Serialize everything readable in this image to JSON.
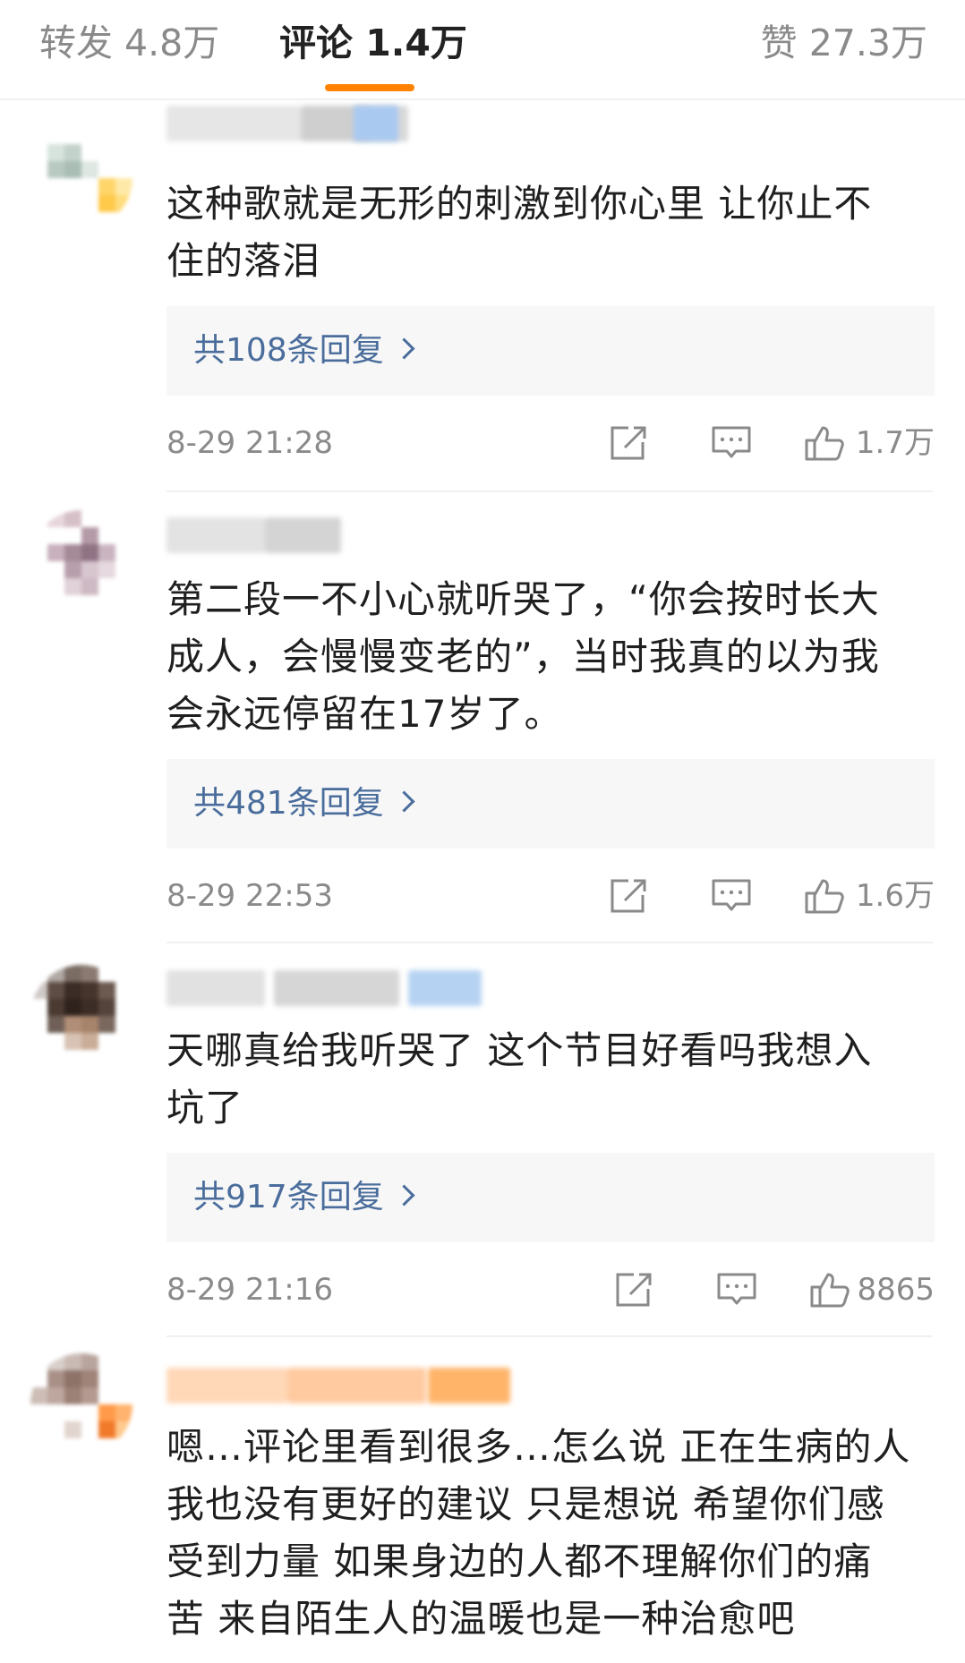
{
  "header": {
    "repost_label": "转发 4.8万",
    "comment_label": "评论 1.4万",
    "like_label": "赞 27.3万"
  },
  "comments": [
    {
      "text_lines": [
        "这种歌就是无形的刺激到你心里 让你止不",
        "住的落泪"
      ],
      "reply_label": "共108条回复",
      "time": "8-29 21:28",
      "likes": "1.7万"
    },
    {
      "text_lines": [
        "第二段一不小心就听哭了，“你会按时长大",
        "成人，会慢慢变老的”，当时我真的以为我",
        "会永远停留在17岁了。"
      ],
      "reply_label": "共481条回复",
      "time": "8-29 22:53",
      "likes": "1.6万"
    },
    {
      "text_lines": [
        "天哪真给我听哭了 这个节目好看吗我想入",
        "坑了"
      ],
      "reply_label": "共917条回复",
      "time": "8-29 21:16",
      "likes": "8865"
    },
    {
      "text_lines": [
        "嗯…评论里看到很多…怎么说 正在生病的人",
        "我也没有更好的建议 只是想说 希望你们感",
        "受到力量 如果身边的人都不理解你们的痛",
        "苦 来自陌生人的温暖也是一种治愈吧"
      ]
    }
  ],
  "colors": {
    "accent_underline": "#ff8200",
    "reply_link": "#4a6d9c",
    "reply_background": "#f7f7f7",
    "meta_text": "#8a8a8a"
  },
  "icons": [
    "share-icon",
    "comment-icon",
    "thumbs-up-icon",
    "chevron-right-icon"
  ]
}
